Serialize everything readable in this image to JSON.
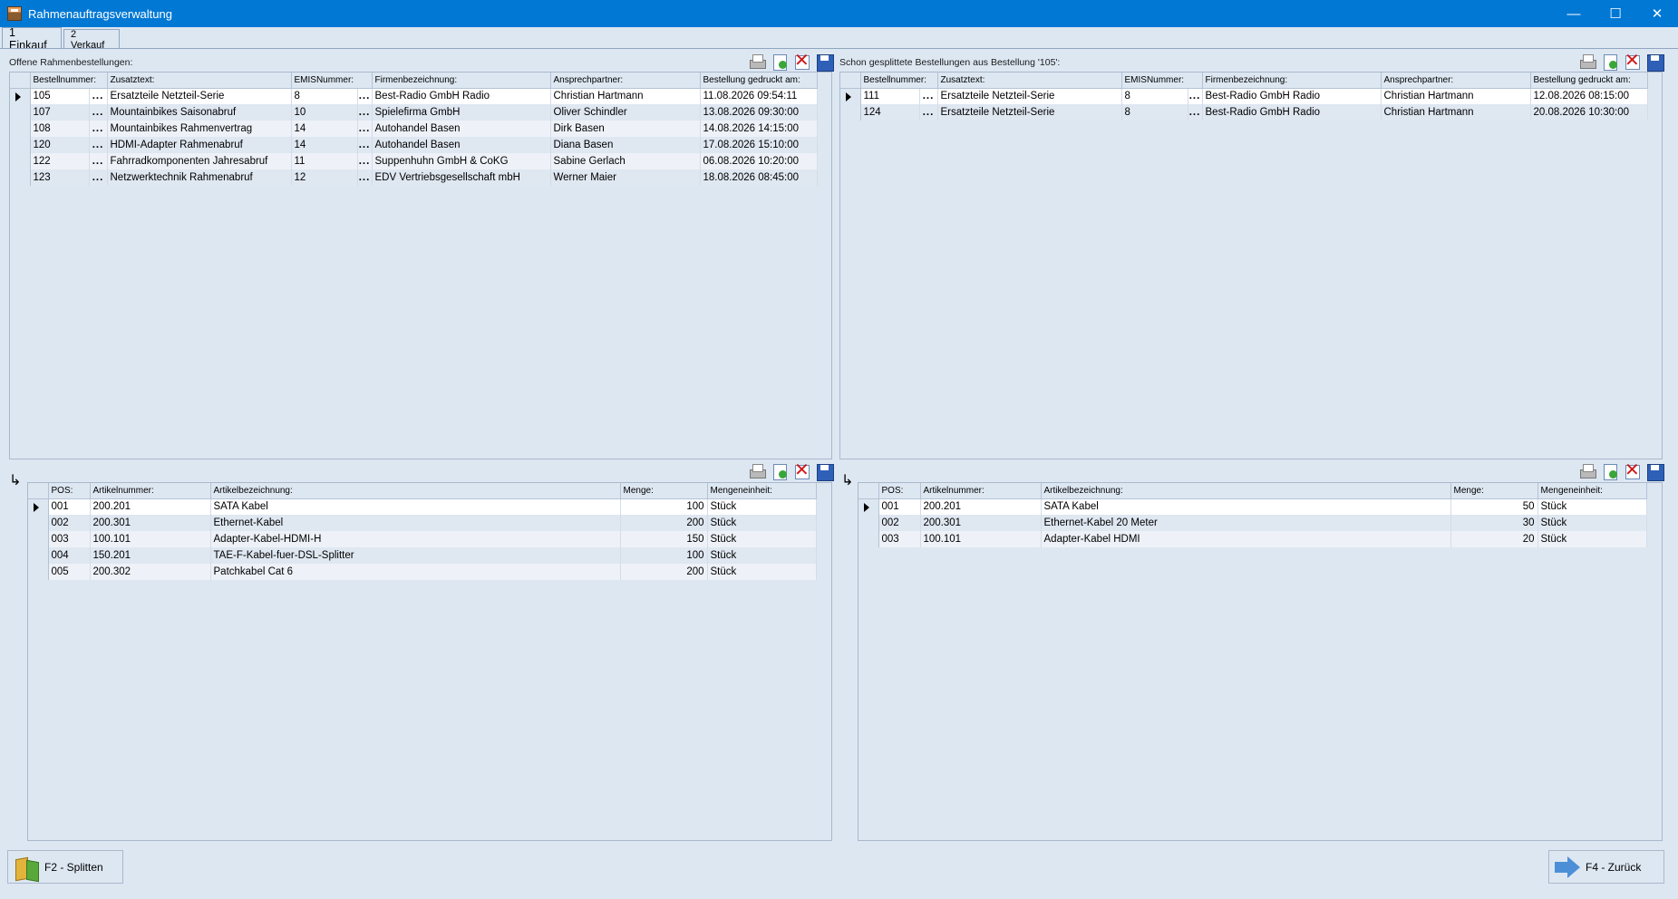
{
  "window": {
    "title": "Rahmenauftragsverwaltung",
    "minimize": "—",
    "maximize": "☐",
    "close": "✕"
  },
  "tabs": [
    {
      "label": "1 Einkauf"
    },
    {
      "label": "2 Verkauf"
    }
  ],
  "top_left": {
    "label": "Offene Rahmenbestellungen:",
    "columns": [
      "Bestellnummer:",
      "Zusatztext:",
      "EMISNummer:",
      "Firmenbezeichnung:",
      "Ansprechpartner:",
      "Bestellung gedruckt am:"
    ],
    "rows": [
      [
        "105",
        "Ersatzteile Netzteil-Serie",
        "8",
        "Best-Radio GmbH Radio",
        "Christian Hartmann",
        "11.08.2026 09:54:11"
      ],
      [
        "107",
        "Mountainbikes Saisonabruf",
        "10",
        "Spielefirma GmbH",
        "Oliver Schindler",
        "13.08.2026 09:30:00"
      ],
      [
        "108",
        "Mountainbikes Rahmenvertrag",
        "14",
        "Autohandel Basen",
        "Dirk Basen",
        "14.08.2026 14:15:00"
      ],
      [
        "120",
        "HDMI-Adapter Rahmenabruf",
        "14",
        "Autohandel Basen",
        "Diana Basen",
        "17.08.2026 15:10:00"
      ],
      [
        "122",
        "Fahrradkomponenten Jahresabruf",
        "11",
        "Suppenhuhn GmbH & CoKG",
        "Sabine Gerlach",
        "06.08.2026 10:20:00"
      ],
      [
        "123",
        "Netzwerktechnik Rahmenabruf",
        "12",
        "EDV Vertriebsgesellschaft mbH",
        "Werner Maier",
        "18.08.2026 08:45:00"
      ]
    ]
  },
  "top_right": {
    "label": "Schon gesplittete Bestellungen aus Bestellung '105':",
    "columns": [
      "Bestellnummer:",
      "Zusatztext:",
      "EMISNummer:",
      "Firmenbezeichnung:",
      "Ansprechpartner:",
      "Bestellung gedruckt am:"
    ],
    "rows": [
      [
        "111",
        "Ersatzteile Netzteil-Serie",
        "8",
        "Best-Radio GmbH Radio",
        "Christian Hartmann",
        "12.08.2026 08:15:00"
      ],
      [
        "124",
        "Ersatzteile Netzteil-Serie",
        "8",
        "Best-Radio GmbH Radio",
        "Christian Hartmann",
        "20.08.2026 10:30:00"
      ]
    ]
  },
  "bottom_left": {
    "columns": [
      "POS:",
      "Artikelnummer:",
      "Artikelbezeichnung:",
      "Menge:",
      "Mengeneinheit:"
    ],
    "rows": [
      [
        "001",
        "200.201",
        "SATA Kabel",
        "100",
        "Stück"
      ],
      [
        "002",
        "200.301",
        "Ethernet-Kabel",
        "200",
        "Stück"
      ],
      [
        "003",
        "100.101",
        "Adapter-Kabel-HDMI-H",
        "150",
        "Stück"
      ],
      [
        "004",
        "150.201",
        "TAE-F-Kabel-fuer-DSL-Splitter",
        "100",
        "Stück"
      ],
      [
        "005",
        "200.302",
        "Patchkabel Cat 6",
        "200",
        "Stück"
      ]
    ]
  },
  "bottom_right": {
    "columns": [
      "POS:",
      "Artikelnummer:",
      "Artikelbezeichnung:",
      "Menge:",
      "Mengeneinheit:"
    ],
    "rows": [
      [
        "001",
        "200.201",
        "SATA Kabel",
        "50",
        "Stück"
      ],
      [
        "002",
        "200.301",
        "Ethernet-Kabel 20 Meter",
        "30",
        "Stück"
      ],
      [
        "003",
        "100.101",
        "Adapter-Kabel HDMI",
        "20",
        "Stück"
      ]
    ]
  },
  "dots": "...",
  "link_glyph": "↳",
  "buttons": {
    "split": "F2 - Splitten",
    "back": "F4 - Zurück"
  },
  "icons": [
    "print-icon",
    "new-document-icon",
    "delete-icon",
    "save-icon",
    "split-icon",
    "back-arrow-icon"
  ]
}
